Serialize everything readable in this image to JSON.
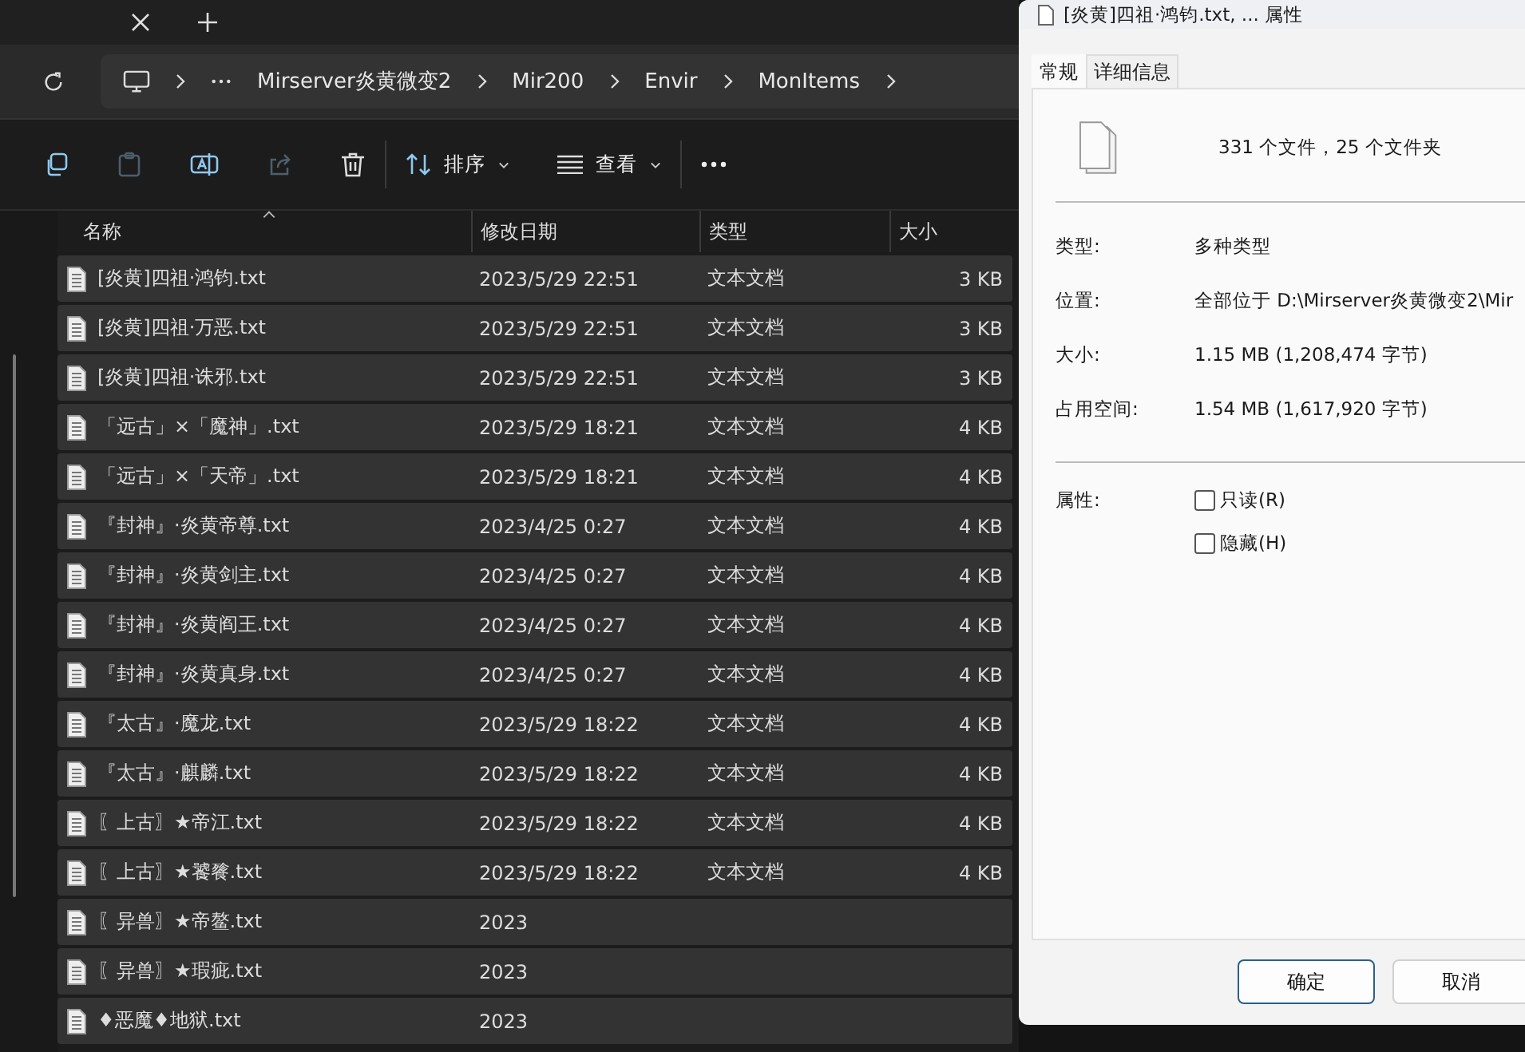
{
  "explorer": {
    "breadcrumb": [
      "Mirserver炎黄微变2",
      "Mir200",
      "Envir",
      "MonItems"
    ],
    "toolbar": [
      {
        "kind": "copy",
        "disabled": false
      },
      {
        "kind": "paste",
        "disabled": true
      },
      {
        "kind": "rename",
        "disabled": false
      },
      {
        "kind": "share",
        "disabled": true
      },
      {
        "kind": "delete",
        "disabled": false
      }
    ],
    "sort_label": "排序",
    "view_label": "查看",
    "columns": [
      {
        "label": "名称",
        "sorted": true
      },
      {
        "label": "修改日期",
        "sorted": false
      },
      {
        "label": "类型",
        "sorted": false
      },
      {
        "label": "大小",
        "sorted": false
      }
    ],
    "rows": [
      {
        "name": "[炎黄]四祖·鸿钧.txt",
        "date": "2023/5/29 22:51",
        "type": "文本文档",
        "size": "3 KB",
        "selected": true
      },
      {
        "name": "[炎黄]四祖·万恶.txt",
        "date": "2023/5/29 22:51",
        "type": "文本文档",
        "size": "3 KB",
        "selected": true
      },
      {
        "name": "[炎黄]四祖·诛邪.txt",
        "date": "2023/5/29 22:51",
        "type": "文本文档",
        "size": "3 KB",
        "selected": true
      },
      {
        "name": "「远古」×「魔神」.txt",
        "date": "2023/5/29 18:21",
        "type": "文本文档",
        "size": "4 KB",
        "selected": true
      },
      {
        "name": "「远古」×「天帝」.txt",
        "date": "2023/5/29 18:21",
        "type": "文本文档",
        "size": "4 KB",
        "selected": true
      },
      {
        "name": "『封神』·炎黄帝尊.txt",
        "date": "2023/4/25 0:27",
        "type": "文本文档",
        "size": "4 KB",
        "selected": true
      },
      {
        "name": "『封神』·炎黄剑主.txt",
        "date": "2023/4/25 0:27",
        "type": "文本文档",
        "size": "4 KB",
        "selected": true
      },
      {
        "name": "『封神』·炎黄阎王.txt",
        "date": "2023/4/25 0:27",
        "type": "文本文档",
        "size": "4 KB",
        "selected": true
      },
      {
        "name": "『封神』·炎黄真身.txt",
        "date": "2023/4/25 0:27",
        "type": "文本文档",
        "size": "4 KB",
        "selected": true
      },
      {
        "name": "『太古』·魔龙.txt",
        "date": "2023/5/29 18:22",
        "type": "文本文档",
        "size": "4 KB",
        "selected": true
      },
      {
        "name": "『太古』·麒麟.txt",
        "date": "2023/5/29 18:22",
        "type": "文本文档",
        "size": "4 KB",
        "selected": true
      },
      {
        "name": "〖上古〗★帝江.txt",
        "date": "2023/5/29 18:22",
        "type": "文本文档",
        "size": "4 KB",
        "selected": true
      },
      {
        "name": "〖上古〗★饕餮.txt",
        "date": "2023/5/29 18:22",
        "type": "文本文档",
        "size": "4 KB",
        "selected": true
      },
      {
        "name": "〖异兽〗★帝鳌.txt",
        "date": "2023",
        "selected": true
      },
      {
        "name": "〖异兽〗★瑕疵.txt",
        "date": "2023",
        "selected": true
      },
      {
        "name": "♦恶魔♦地狱.txt",
        "date": "2023",
        "selected": true
      }
    ]
  },
  "dialog": {
    "title": "[炎黄]四祖·鸿钧.txt, ... 属性",
    "tabs": [
      {
        "label": "常规",
        "selected": true
      },
      {
        "label": "详细信息",
        "selected": false
      }
    ],
    "summary": "331 个文件，25 个文件夹",
    "properties": [
      {
        "label": "类型:",
        "value": "多种类型"
      },
      {
        "label": "位置:",
        "value": "全部位于 D:\\Mirserver炎黄微变2\\Mir"
      }
    ],
    "sizes": [
      {
        "label": "大小:",
        "value": "1.15 MB (1,208,474 字节)"
      },
      {
        "label": "占用空间:",
        "value": "1.54 MB (1,617,920 字节)"
      }
    ],
    "attributes_label": "属性:",
    "attributes": [
      {
        "label": "只读(R)",
        "checked": false
      },
      {
        "label": "隐藏(H)",
        "checked": false
      }
    ],
    "buttons": [
      {
        "label": "确定",
        "default": true
      },
      {
        "label": "取消",
        "default": false
      }
    ]
  }
}
